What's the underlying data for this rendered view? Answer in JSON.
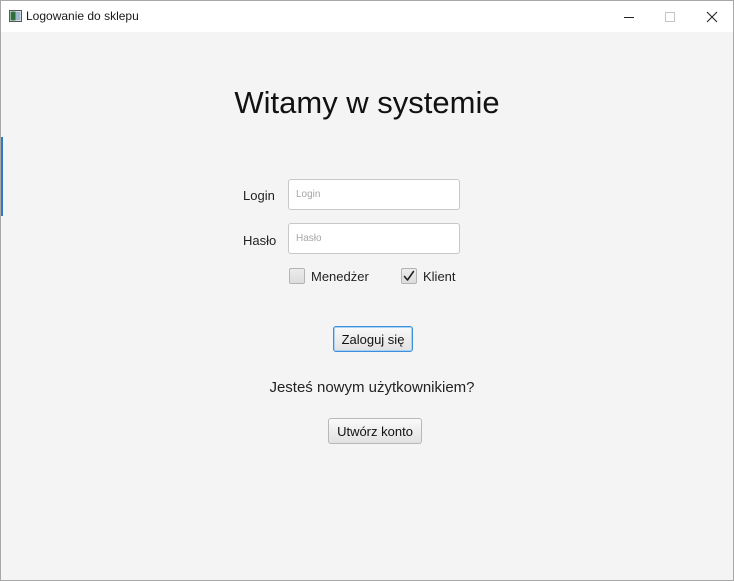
{
  "window": {
    "title": "Logowanie do sklepu",
    "controls": {
      "minimize": "minimize-icon",
      "maximize": "maximize-icon",
      "close": "close-icon"
    }
  },
  "main": {
    "heading": "Witamy w systemie",
    "login": {
      "label": "Login",
      "placeholder": "Login",
      "value": ""
    },
    "password": {
      "label": "Hasło",
      "placeholder": "Hasło",
      "value": ""
    },
    "roles": [
      {
        "label": "Menedżer",
        "checked": false
      },
      {
        "label": "Klient",
        "checked": true
      }
    ],
    "login_button": "Zaloguj się",
    "new_user_question": "Jesteś nowym użytkownikiem?",
    "create_account_button": "Utwórz konto"
  },
  "colors": {
    "focus_accent": "#3c8fd8"
  }
}
